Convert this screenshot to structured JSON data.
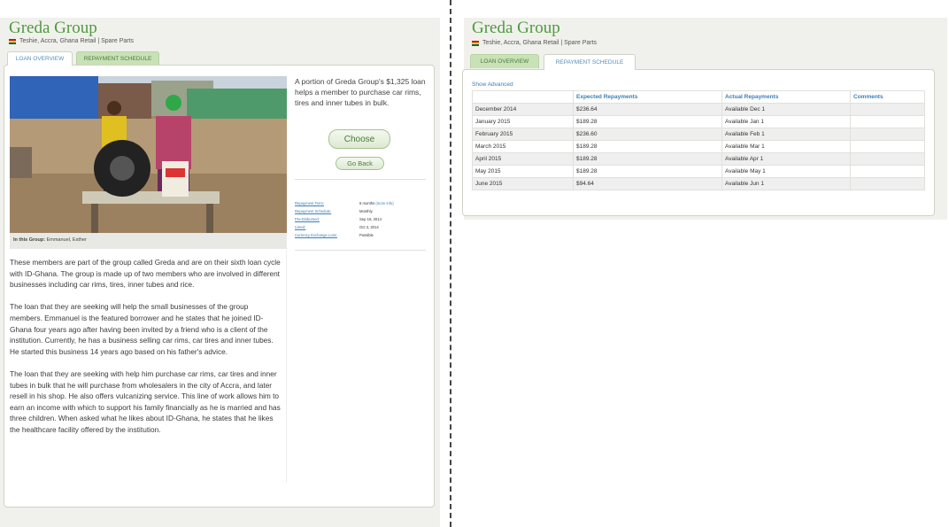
{
  "left": {
    "title": "Greda Group",
    "location": "Teshie, Accra, Ghana Retail | Spare Parts",
    "tabs": [
      {
        "label": "LOAN OVERVIEW"
      },
      {
        "label": "REPAYMENT SCHEDULE"
      }
    ],
    "photo_caption_label": "In this Group:",
    "photo_caption_names": " Emmanuel, Esther",
    "pitch": "A portion of Greda Group's $1,325 loan helps a member to purchase car rims, tires and inner tubes in bulk.",
    "choose_label": "Choose",
    "back_label": "Go Back",
    "meta": [
      {
        "key": "Repayment Term:",
        "value": "6 months ",
        "link": "(more info)"
      },
      {
        "key": "Repayment Schedule:",
        "value": "Monthly",
        "link": ""
      },
      {
        "key": "Pre-Disbursed:",
        "value": "Sep 16, 2014",
        "link": ""
      },
      {
        "key": "Listed:",
        "value": "Oct 3, 2014",
        "link": ""
      },
      {
        "key": "Currency Exchange Loss:",
        "value": "Possible",
        "link": ""
      }
    ],
    "description": [
      "These members are part of the group called Greda and are on their sixth loan cycle with ID-Ghana. The group is made up of two members who are involved in different businesses including car rims, tires, inner tubes and rice.",
      "The loan that they are seeking will help the small businesses of the group members. Emmanuel is the featured borrower and he states that he joined ID-Ghana four years ago after having been invited by a friend who is a client of the institution. Currently, he has a business selling car rims, car tires and inner tubes. He started this business 14 years ago based on his father's advice.",
      "The loan that they are seeking with help him purchase car rims, car tires and inner tubes in bulk that he will purchase from wholesalers in the city of Accra, and later resell in his shop. He also offers vulcanizing service. This line of work allows him to earn an income with which to support his family financially as he is married and has three children. When asked what he likes about ID-Ghana, he states that he likes the healthcare facility offered by the institution."
    ]
  },
  "right": {
    "title": "Greda Group",
    "location": "Teshie, Accra, Ghana Retail | Spare Parts",
    "tabs": [
      {
        "label": "LOAN OVERVIEW"
      },
      {
        "label": "REPAYMENT SCHEDULE"
      }
    ],
    "show_advanced": "Show Advanced",
    "columns": [
      "",
      "Expected Repayments",
      "Actual Repayments",
      "Comments"
    ],
    "rows": [
      [
        "December 2014",
        "$236.64",
        "Available Dec 1",
        ""
      ],
      [
        "January 2015",
        "$189.28",
        "Available Jan 1",
        ""
      ],
      [
        "February 2015",
        "$236.60",
        "Available Feb 1",
        ""
      ],
      [
        "March 2015",
        "$189.28",
        "Available Mar 1",
        ""
      ],
      [
        "April 2015",
        "$189.28",
        "Available Apr 1",
        ""
      ],
      [
        "May 2015",
        "$189.28",
        "Available May 1",
        ""
      ],
      [
        "June 2015",
        "$94.64",
        "Available Jun 1",
        ""
      ]
    ]
  },
  "colors": {
    "brand_green": "#4f9a3d",
    "link_blue": "#3c7fb5",
    "tab_inactive_bg": "#c9e1b6",
    "panel_bg": "#f0f1ec"
  }
}
